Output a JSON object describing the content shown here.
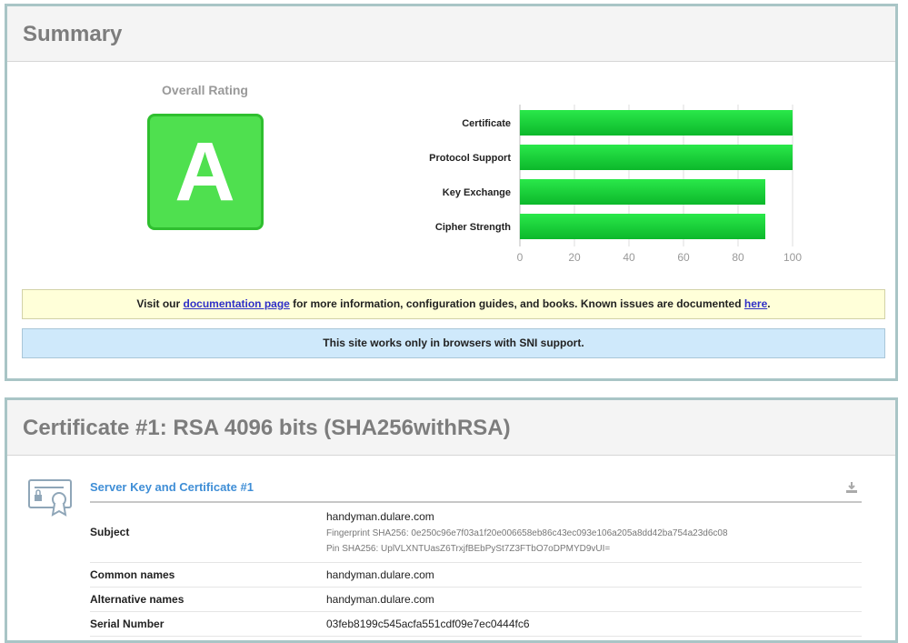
{
  "summary": {
    "title": "Summary",
    "rating_label": "Overall Rating",
    "grade": "A",
    "doc_notice": {
      "prefix": "Visit our ",
      "link1": "documentation page",
      "middle": " for more information, configuration guides, and books. Known issues are documented ",
      "link2": "here",
      "suffix": "."
    },
    "sni_notice": "This site works only in browsers with SNI support."
  },
  "chart_data": {
    "type": "bar",
    "orientation": "horizontal",
    "categories": [
      "Certificate",
      "Protocol Support",
      "Key Exchange",
      "Cipher Strength"
    ],
    "values": [
      100,
      100,
      90,
      90
    ],
    "xlim": [
      0,
      100
    ],
    "ticks": [
      0,
      20,
      40,
      60,
      80,
      100
    ],
    "grid": true,
    "colors": {
      "bar": "#11cc33",
      "bar_light": "#22ee44"
    }
  },
  "certificate": {
    "title": "Certificate #1: RSA 4096 bits (SHA256withRSA)",
    "section_title": "Server Key and Certificate #1",
    "rows": {
      "subject": {
        "key": "Subject",
        "value": "handyman.dulare.com",
        "fingerprint": "Fingerprint SHA256: 0e250c96e7f03a1f20e006658eb86c43ec093e106a205a8dd42ba754a23d6c08",
        "pin": "Pin SHA256: UplVLXNTUasZ6TrxjfBEbPySt7Z3FTbO7oDPMYD9vUI="
      },
      "common_names": {
        "key": "Common names",
        "value": "handyman.dulare.com"
      },
      "alternative_names": {
        "key": "Alternative names",
        "value": "handyman.dulare.com"
      },
      "serial_number": {
        "key": "Serial Number",
        "value": "03feb8199c545acfa551cdf09e7ec0444fc6"
      }
    }
  }
}
